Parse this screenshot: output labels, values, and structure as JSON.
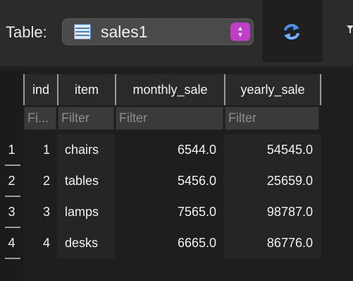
{
  "toolbar": {
    "table_label": "Table:",
    "selected_table": "sales1",
    "table_icon": "table-icon",
    "refresh_icon": "refresh-icon",
    "accent_color": "#c13ec9"
  },
  "table": {
    "columns": [
      "ind",
      "item",
      "monthly_sale",
      "yearly_sale"
    ],
    "filters": [
      "Fi...",
      "Filter",
      "Filter",
      "Filter"
    ],
    "rows": [
      {
        "rownum": "1",
        "ind": "1",
        "item": "chairs",
        "monthly_sale": "6544.0",
        "yearly_sale": "54545.0"
      },
      {
        "rownum": "2",
        "ind": "2",
        "item": "tables",
        "monthly_sale": "5456.0",
        "yearly_sale": "25659.0"
      },
      {
        "rownum": "3",
        "ind": "3",
        "item": "lamps",
        "monthly_sale": "7565.0",
        "yearly_sale": "98787.0"
      },
      {
        "rownum": "4",
        "ind": "4",
        "item": "desks",
        "monthly_sale": "6665.0",
        "yearly_sale": "86776.0"
      }
    ]
  }
}
